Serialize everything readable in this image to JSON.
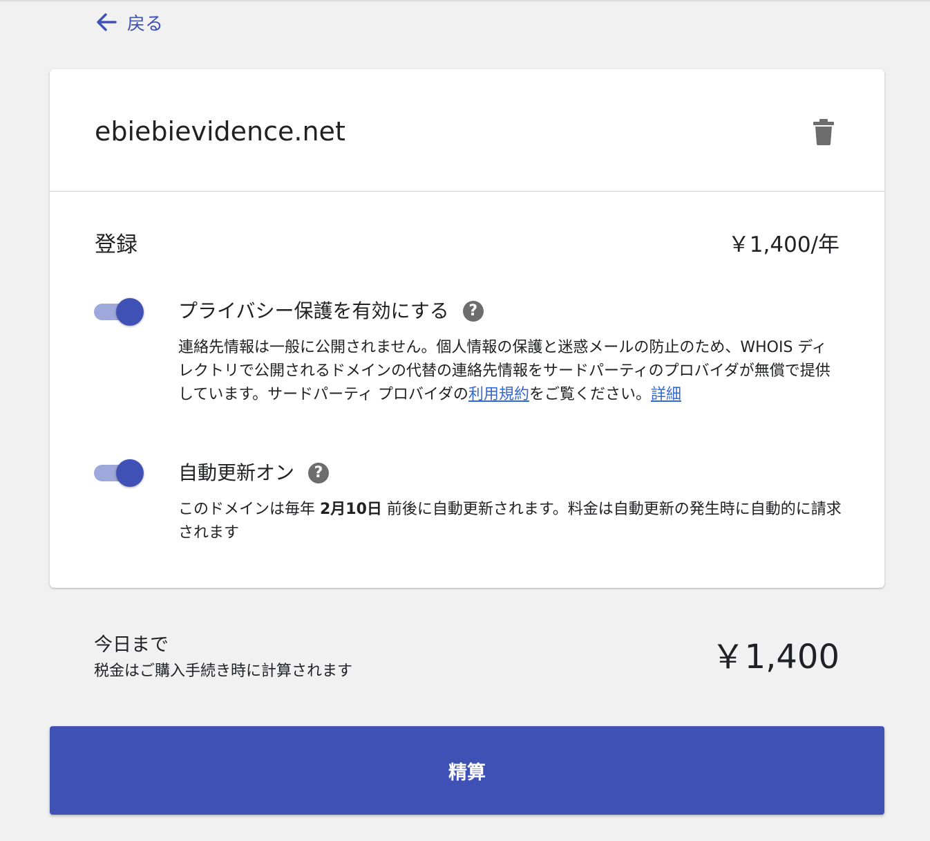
{
  "nav": {
    "back_label": "戻る"
  },
  "domain": {
    "name": "ebiebievidence.net"
  },
  "registration": {
    "label": "登録",
    "price": "￥1,400/年"
  },
  "privacy": {
    "enabled": true,
    "title": "プライバシー保護を有効にする",
    "help_glyph": "?",
    "desc_part1": "連絡先情報は一般に公開されません。個人情報の保護と迷惑メールの防止のため、WHOIS ディレクトリで公開されるドメインの代替の連絡先情報をサードパーティのプロバイダが無償で提供しています。サードパーティ プロバイダの",
    "terms_link": "利用規約",
    "desc_part2": "をご覧ください。",
    "details_link": "詳細"
  },
  "auto_renew": {
    "enabled": true,
    "title": "自動更新オン",
    "help_glyph": "?",
    "desc_part1": "このドメインは毎年 ",
    "renew_date": "2月10日",
    "desc_part2": " 前後に自動更新されます。料金は自動更新の発生時に自動的に請求されます"
  },
  "summary": {
    "today_label": "今日まで",
    "tax_note": "税金はご購入手続き時に計算されます",
    "total": "￥1,400"
  },
  "checkout": {
    "label": "精算"
  },
  "colors": {
    "accent": "#3f51b5",
    "toggle_track": "#9fa8da",
    "link": "#3367d6",
    "background": "#f1f1f1",
    "card": "#ffffff",
    "icon_gray": "#6d6d6d"
  },
  "icons": {
    "back": "arrow-left-icon",
    "delete": "trash-icon",
    "help": "help-circle-icon"
  }
}
